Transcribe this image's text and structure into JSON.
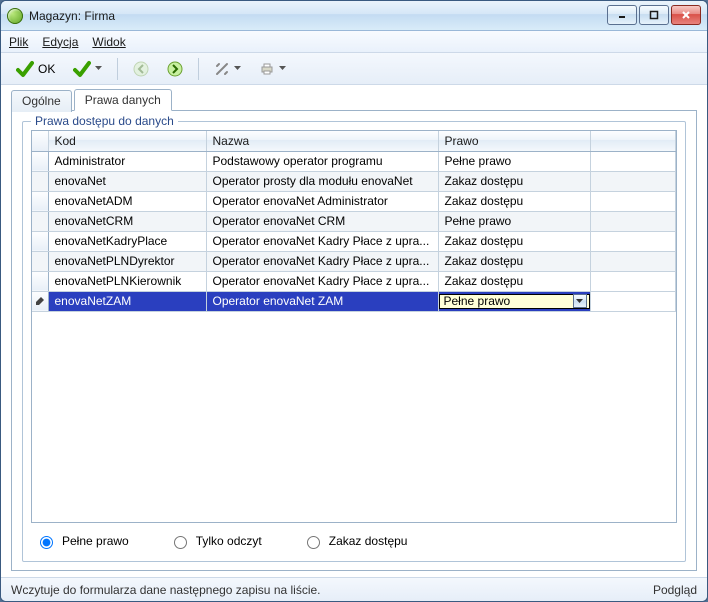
{
  "window": {
    "title": "Magazyn: Firma"
  },
  "menu": {
    "plik": "Plik",
    "edycja": "Edycja",
    "widok": "Widok"
  },
  "toolbar": {
    "ok_label": "OK"
  },
  "tabs": {
    "ogolne": "Ogólne",
    "prawa": "Prawa danych"
  },
  "group": {
    "title": "Prawa dostępu do danych"
  },
  "columns": {
    "kod": "Kod",
    "nazwa": "Nazwa",
    "prawo": "Prawo"
  },
  "rows": [
    {
      "kod": "Administrator",
      "nazwa": "Podstawowy operator programu",
      "prawo": "Pełne prawo"
    },
    {
      "kod": "enovaNet",
      "nazwa": "Operator prosty dla modułu enovaNet",
      "prawo": "Zakaz dostępu"
    },
    {
      "kod": "enovaNetADM",
      "nazwa": "Operator enovaNet Administrator",
      "prawo": "Zakaz dostępu"
    },
    {
      "kod": "enovaNetCRM",
      "nazwa": "Operator enovaNet CRM",
      "prawo": "Pełne prawo"
    },
    {
      "kod": "enovaNetKadryPlace",
      "nazwa": "Operator enovaNet Kadry Płace z upra...",
      "prawo": "Zakaz dostępu"
    },
    {
      "kod": "enovaNetPLNDyrektor",
      "nazwa": "Operator enovaNet Kadry Płace z upra...",
      "prawo": "Zakaz dostępu"
    },
    {
      "kod": "enovaNetPLNKierownik",
      "nazwa": "Operator enovaNet Kadry Płace z upra...",
      "prawo": "Zakaz dostępu"
    },
    {
      "kod": "enovaNetZAM",
      "nazwa": "Operator enovaNet ZAM",
      "prawo": "Pełne prawo"
    }
  ],
  "radios": {
    "pelne": "Pełne prawo",
    "odczyt": "Tylko odczyt",
    "zakaz": "Zakaz dostępu",
    "selected": "pelne"
  },
  "status": {
    "left": "Wczytuje do formularza dane następnego zapisu na liście.",
    "right": "Podgląd"
  }
}
